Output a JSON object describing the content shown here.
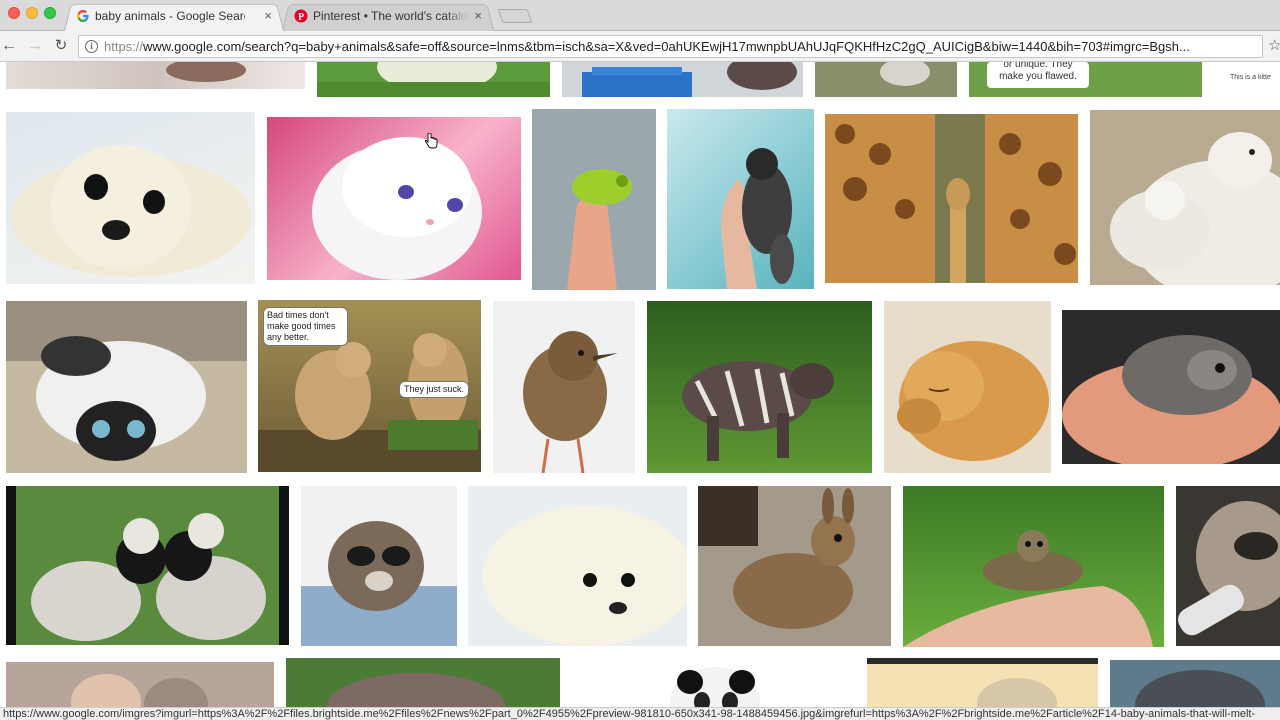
{
  "browser": {
    "tabs": [
      {
        "title": "baby animals - Google Search",
        "close": "×",
        "active": true
      },
      {
        "title": "Pinterest • The world's catalog",
        "close": "×",
        "active": false
      }
    ],
    "url_scheme": "https://",
    "url_rest": "www.google.com/search?q=baby+animals&safe=off&source=lnms&tbm=isch&sa=X&ved=0ahUKEwjH17mwnpbUAhUJqFQKHfHzC2gQ_AUICigB&biw=1440&bih=703#imgrc=Bgsh...",
    "status_url": "https://www.google.com/imgres?imgurl=https%3A%2F%2Ffiles.brightside.me%2Ffiles%2Fnews%2Fpart_0%2F4955%2Fpreview-981810-650x341-98-1488459456.jpg&imgrefurl=https%3A%2F%2Fbrightside.me%2Farticle%2F14-baby-animals-that-will-melt-"
  },
  "images": {
    "top_partial_text": "or unique. They make you flawed.",
    "top_right_text": "This is a kitte",
    "meme_top": "Bad times don't make good times any better.",
    "meme_bottom": "They just suck."
  },
  "colors": {
    "accent_google": "#4285f4",
    "pinterest": "#e60023"
  },
  "icons": {
    "back": "←",
    "forward": "→",
    "reload": "↻",
    "info": "i",
    "bookmark": "☆"
  }
}
